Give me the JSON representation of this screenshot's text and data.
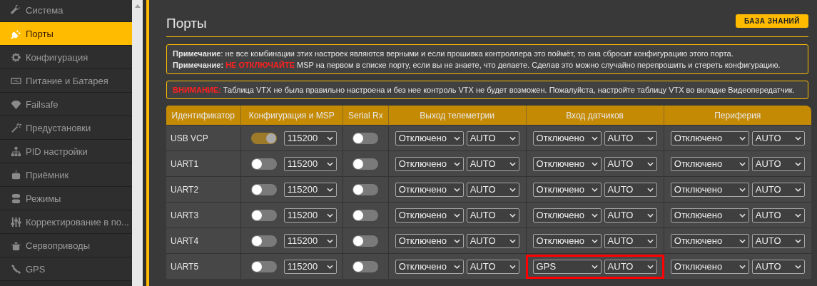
{
  "sidebar": {
    "items": [
      {
        "label": "Система",
        "selected": false
      },
      {
        "label": "Порты",
        "selected": true
      },
      {
        "label": "Конфигурация",
        "selected": false
      },
      {
        "label": "Питание и Батарея",
        "selected": false
      },
      {
        "label": "Failsafe",
        "selected": false
      },
      {
        "label": "Предустановки",
        "selected": false
      },
      {
        "label": "PID настройки",
        "selected": false
      },
      {
        "label": "Приёмник",
        "selected": false
      },
      {
        "label": "Режимы",
        "selected": false
      },
      {
        "label": "Корректирование в по...",
        "selected": false
      },
      {
        "label": "Сервоприводы",
        "selected": false
      },
      {
        "label": "GPS",
        "selected": false
      }
    ]
  },
  "header": {
    "title": "Порты",
    "help_button": "БАЗА ЗНАНИЙ"
  },
  "notes": [
    [
      {
        "kind": "strong",
        "text": "Примечание"
      },
      {
        "kind": "plain",
        "text": ": не все комбинации этих настроек являются верными и если прошивка контроллера это поймёт, то она сбросит конфигурацию этого порта."
      }
    ],
    [
      {
        "kind": "strong",
        "text": "Примечание: "
      },
      {
        "kind": "alert",
        "text": "НЕ ОТКЛЮЧАЙТЕ"
      },
      {
        "kind": "plain",
        "text": " MSP на первом в списке порту, если вы не знаете, что делаете. Сделав это можно случайно перепрошить и стереть конфигурацию."
      }
    ]
  ],
  "warning": [
    {
      "kind": "alert",
      "text": "ВНИМАНИЕ:"
    },
    {
      "kind": "plain",
      "text": " Таблица VTX не была правильно настроена и без нее контроль VTX не будет возможен. Пожалуйста, настройте таблицу VTX во вкладке Видеопередатчик."
    }
  ],
  "table": {
    "columns": [
      "Идентификатор",
      "Конфигурация и MSP",
      "Serial Rx",
      "Выход телеметрии",
      "Вход датчиков",
      "Периферия"
    ],
    "rows": [
      {
        "id": "USB VCP",
        "msp": {
          "on": true,
          "speed": "115200"
        },
        "serial_rx": {
          "on": false
        },
        "telemetry": {
          "value": "Отключено",
          "speed": "AUTO"
        },
        "sensor": {
          "value": "Отключено",
          "speed": "AUTO",
          "highlighted": false
        },
        "peripheral": {
          "value": "Отключено",
          "speed": "AUTO"
        }
      },
      {
        "id": "UART1",
        "msp": {
          "on": false,
          "speed": "115200"
        },
        "serial_rx": {
          "on": false
        },
        "telemetry": {
          "value": "Отключено",
          "speed": "AUTO"
        },
        "sensor": {
          "value": "Отключено",
          "speed": "AUTO",
          "highlighted": false
        },
        "peripheral": {
          "value": "Отключено",
          "speed": "AUTO"
        }
      },
      {
        "id": "UART2",
        "msp": {
          "on": false,
          "speed": "115200"
        },
        "serial_rx": {
          "on": false
        },
        "telemetry": {
          "value": "Отключено",
          "speed": "AUTO"
        },
        "sensor": {
          "value": "Отключено",
          "speed": "AUTO",
          "highlighted": false
        },
        "peripheral": {
          "value": "Отключено",
          "speed": "AUTO"
        }
      },
      {
        "id": "UART3",
        "msp": {
          "on": false,
          "speed": "115200"
        },
        "serial_rx": {
          "on": false
        },
        "telemetry": {
          "value": "Отключено",
          "speed": "AUTO"
        },
        "sensor": {
          "value": "Отключено",
          "speed": "AUTO",
          "highlighted": false
        },
        "peripheral": {
          "value": "Отключено",
          "speed": "AUTO"
        }
      },
      {
        "id": "UART4",
        "msp": {
          "on": false,
          "speed": "115200"
        },
        "serial_rx": {
          "on": false
        },
        "telemetry": {
          "value": "Отключено",
          "speed": "AUTO"
        },
        "sensor": {
          "value": "Отключено",
          "speed": "AUTO",
          "highlighted": false
        },
        "peripheral": {
          "value": "Отключено",
          "speed": "AUTO"
        }
      },
      {
        "id": "UART5",
        "msp": {
          "on": false,
          "speed": "115200"
        },
        "serial_rx": {
          "on": false
        },
        "telemetry": {
          "value": "Отключено",
          "speed": "AUTO"
        },
        "sensor": {
          "value": "GPS",
          "speed": "AUTO",
          "highlighted": true
        },
        "peripheral": {
          "value": "Отключено",
          "speed": "AUTO"
        }
      }
    ]
  }
}
